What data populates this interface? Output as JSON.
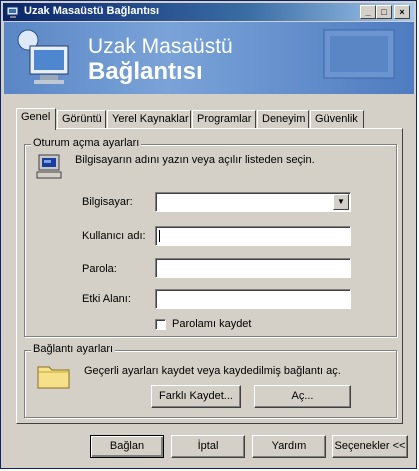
{
  "window": {
    "title": "Uzak Masaüstü Bağlantısı",
    "minimize": "_",
    "maximize": "□",
    "close": "×"
  },
  "banner": {
    "line1": "Uzak Masaüstü",
    "line2": "Bağlantısı"
  },
  "tabs": [
    "Genel",
    "Görüntü",
    "Yerel Kaynaklar",
    "Programlar",
    "Deneyim",
    "Güvenlik"
  ],
  "logon": {
    "group_label": "Oturum açma ayarları",
    "description": "Bilgisayarın adını yazın veya açılır listeden seçin.",
    "computer_label": "Bilgisayar:",
    "computer_value": "",
    "username_label": "Kullanıcı adı:",
    "username_value": "",
    "password_label": "Parola:",
    "password_value": "",
    "domain_label": "Etki Alanı:",
    "domain_value": "",
    "save_password_label": "Parolamı kaydet",
    "save_password_checked": false
  },
  "connection": {
    "group_label": "Bağlantı ayarları",
    "description": "Geçerli ayarları kaydet veya kaydedilmiş bağlantı aç.",
    "save_as_button": "Farklı Kaydet...",
    "open_button": "Aç..."
  },
  "footer": {
    "connect": "Bağlan",
    "cancel": "İptal",
    "help": "Yardım",
    "options": "Seçenekler <<"
  },
  "icons": [
    "app-icon",
    "computer-icon",
    "folder-icon",
    "banner-computer-icon"
  ],
  "colors": {
    "title_start": "#0a246a",
    "title_end": "#a6caf0",
    "banner": "#5a86c6",
    "face": "#d4d0c8"
  }
}
